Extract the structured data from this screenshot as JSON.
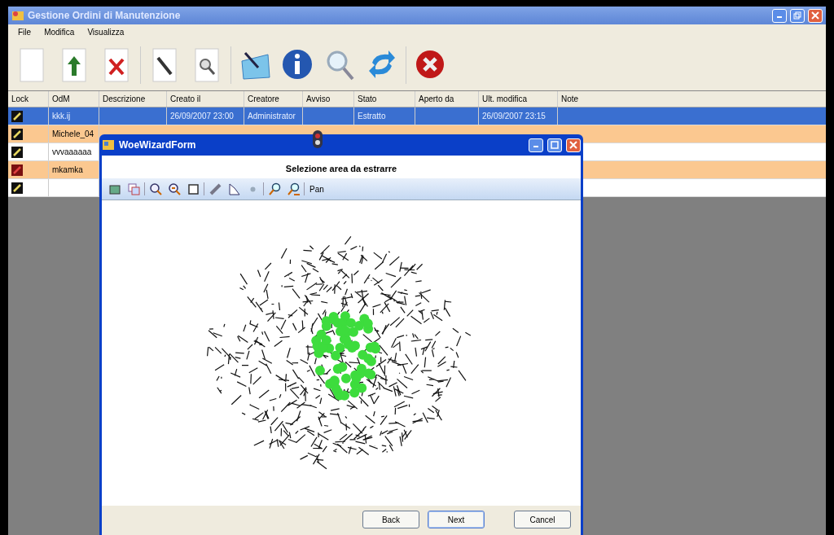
{
  "window": {
    "title": "Gestione Ordini di Manutenzione"
  },
  "menu": [
    "File",
    "Modifica",
    "Visualizza"
  ],
  "toolbar": [
    {
      "kind": "new"
    },
    {
      "kind": "upload"
    },
    {
      "kind": "delete"
    },
    {
      "kind": "edit"
    },
    {
      "kind": "find"
    },
    {
      "kind": "wizard"
    },
    {
      "kind": "info"
    },
    {
      "kind": "search"
    },
    {
      "kind": "refresh"
    },
    {
      "kind": "exit"
    }
  ],
  "table": {
    "columns": [
      "Lock",
      "OdM",
      "Descrizione",
      "Creato il",
      "Creatore",
      "Avviso",
      "Stato",
      "Aperto da",
      "Ult. modifica",
      "Note"
    ],
    "rows": [
      {
        "locked": false,
        "selected": true,
        "cells": [
          "",
          "kkk.ij",
          "",
          "26/09/2007 23:00",
          "Administrator",
          "",
          "Estratto",
          "",
          "26/09/2007 23:15",
          ""
        ]
      },
      {
        "locked": false,
        "selected": false,
        "color": "#fbc890",
        "cells": [
          "",
          "Michele_04"
        ]
      },
      {
        "locked": false,
        "selected": false,
        "color": "#ffffff",
        "cells": [
          "",
          "vvvaaaaaa"
        ]
      },
      {
        "locked": true,
        "selected": false,
        "color": "#fbc890",
        "cells": [
          "",
          "mkamka"
        ]
      },
      {
        "locked": false,
        "selected": false,
        "color": "#ffffff",
        "cells": [
          "",
          ""
        ]
      }
    ]
  },
  "dialog": {
    "title": "WoeWizardForm",
    "heading": "Selezione area da estrarre",
    "tools": [
      {
        "kind": "layers"
      },
      {
        "kind": "add-layer"
      },
      {
        "kind": "sep"
      },
      {
        "kind": "zoom-in"
      },
      {
        "kind": "zoom-out"
      },
      {
        "kind": "extent"
      },
      {
        "kind": "sep"
      },
      {
        "kind": "measure"
      },
      {
        "kind": "polygon"
      },
      {
        "kind": "point"
      },
      {
        "kind": "sep"
      },
      {
        "kind": "find"
      },
      {
        "kind": "find-all"
      }
    ],
    "pan_label": "Pan",
    "buttons": [
      "Back",
      "Next",
      "Cancel"
    ]
  }
}
